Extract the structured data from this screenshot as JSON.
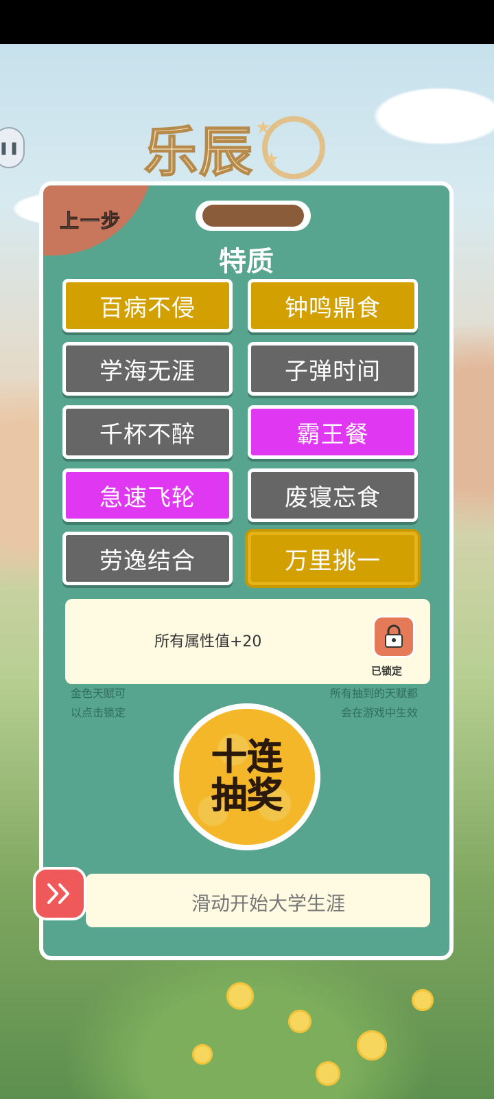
{
  "game": {
    "logo_text": "乐辰",
    "back_label": "上一步",
    "section_title": "特质",
    "traits": [
      {
        "label": "百病不侵",
        "rarity": "gold"
      },
      {
        "label": "钟鸣鼎食",
        "rarity": "gold"
      },
      {
        "label": "学海无涯",
        "rarity": "gray"
      },
      {
        "label": "子弹时间",
        "rarity": "gray"
      },
      {
        "label": "千杯不醉",
        "rarity": "gray"
      },
      {
        "label": "霸王餐",
        "rarity": "purple"
      },
      {
        "label": "急速飞轮",
        "rarity": "purple"
      },
      {
        "label": "废寝忘食",
        "rarity": "gray"
      },
      {
        "label": "劳逸结合",
        "rarity": "gray"
      },
      {
        "label": "万里挑一",
        "rarity": "gold",
        "selected": true
      }
    ],
    "selected_description": "所有属性值+20",
    "lock_label": "已锁定",
    "hint_left": "金色天赋可以点击锁定",
    "hint_left_lines": [
      "金色天赋可",
      "以点击锁定"
    ],
    "hint_right_lines": [
      "所有抽到的天赋都",
      "会在游戏中生效"
    ],
    "draw_button_label": "十连抽奖",
    "slider_label": "滑动开始大学生涯",
    "slider_icon": "double-chevron-right-icon",
    "colors": {
      "panel": "#57a48f",
      "gold": "#d2a000",
      "gray": "#666666",
      "purple": "#e038f2",
      "back_corner": "#c9775c",
      "draw_button": "#f5b72a",
      "slider_knob": "#f0595a"
    }
  }
}
